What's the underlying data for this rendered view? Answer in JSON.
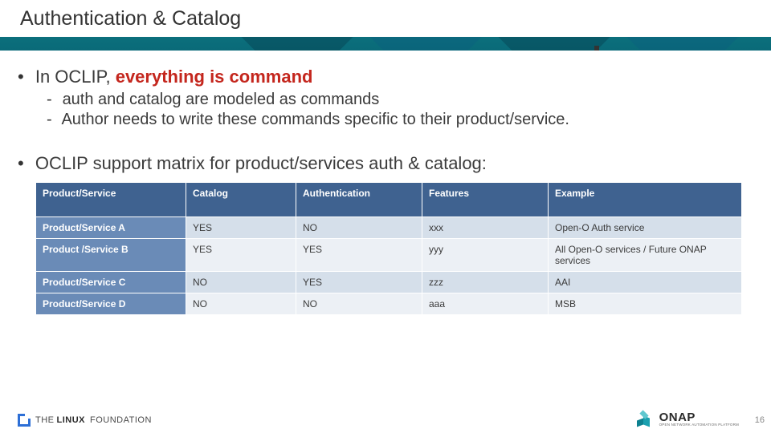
{
  "slide": {
    "title": "Authentication & Catalog",
    "page_number": "16"
  },
  "bullets": {
    "b1_prefix": "In OCLIP, ",
    "b1_emphasis": "everything is command",
    "sub1": "auth and catalog are modeled as commands",
    "sub2": "Author needs to write these commands specific to their product/service.",
    "b2": "OCLIP support matrix for product/services auth & catalog:"
  },
  "table": {
    "headers": [
      "Product/Service",
      "Catalog",
      "Authentication",
      "Features",
      "Example"
    ],
    "rows": [
      {
        "ps": "Product/Service A",
        "catalog": "YES",
        "auth": "NO",
        "features": "xxx",
        "example": "Open-O Auth service"
      },
      {
        "ps": "Product /Service B",
        "catalog": "YES",
        "auth": "YES",
        "features": "yyy",
        "example": "All Open-O services / Future ONAP services"
      },
      {
        "ps": "Product/Service C",
        "catalog": "NO",
        "auth": "YES",
        "features": "zzz",
        "example": "AAI"
      },
      {
        "ps": "Product/Service D",
        "catalog": "NO",
        "auth": "NO",
        "features": "aaa",
        "example": "MSB"
      }
    ]
  },
  "footer": {
    "linux_the": "THE",
    "linux_lf": "LINUX",
    "linux_fd": "FOUNDATION",
    "onap": "ONAP",
    "onap_sub": "OPEN NETWORK AUTOMATION PLATFORM"
  }
}
